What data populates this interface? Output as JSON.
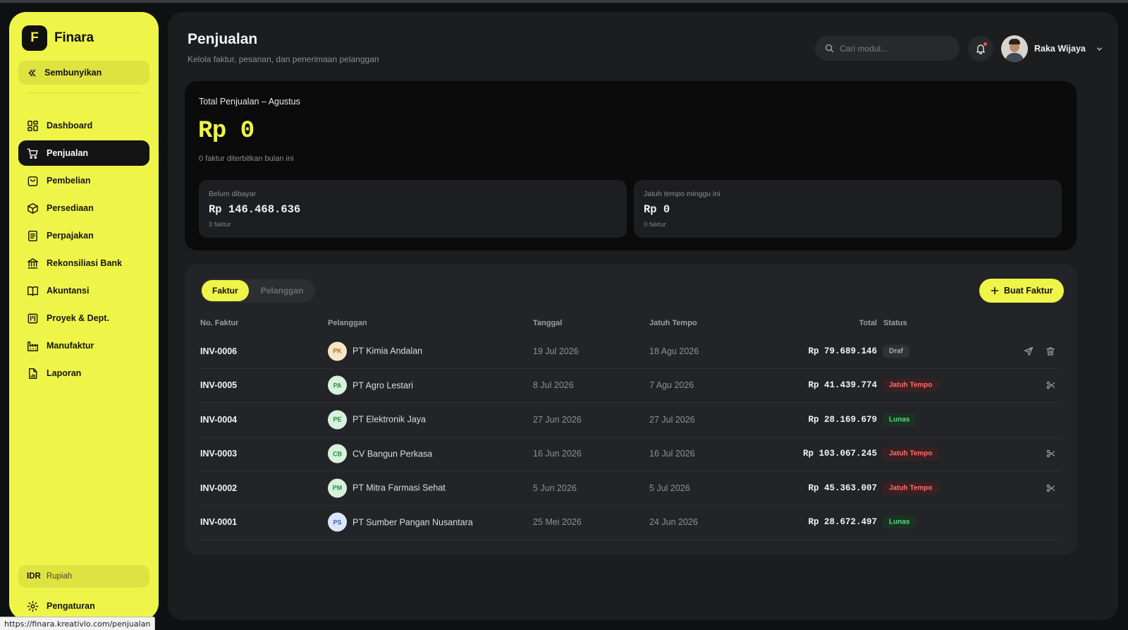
{
  "brand": {
    "logo_letter": "F",
    "name": "Finara"
  },
  "sidebar": {
    "collapse_label": "Sembunyikan",
    "items": [
      {
        "label": "Dashboard",
        "icon": "grid-icon",
        "active": false
      },
      {
        "label": "Penjualan",
        "icon": "cart-icon",
        "active": true
      },
      {
        "label": "Pembelian",
        "icon": "shopping-bag-icon",
        "active": false
      },
      {
        "label": "Persediaan",
        "icon": "box-icon",
        "active": false
      },
      {
        "label": "Perpajakan",
        "icon": "document-icon",
        "active": false
      },
      {
        "label": "Rekonsiliasi Bank",
        "icon": "bank-icon",
        "active": false
      },
      {
        "label": "Akuntansi",
        "icon": "book-icon",
        "active": false
      },
      {
        "label": "Proyek & Dept.",
        "icon": "kanban-icon",
        "active": false
      },
      {
        "label": "Manufaktur",
        "icon": "factory-icon",
        "active": false
      },
      {
        "label": "Laporan",
        "icon": "report-icon",
        "active": false
      }
    ],
    "currency": {
      "code": "IDR",
      "name": "Rupiah"
    },
    "settings_label": "Pengaturan"
  },
  "status_url": "https://finara.kreativlo.com/penjualan",
  "header": {
    "title": "Penjualan",
    "subtitle": "Kelola faktur, pesanan, dan penerimaan pelanggan",
    "search_placeholder": "Cari modul...",
    "user_name": "Raka Wijaya"
  },
  "summary": {
    "title": "Total Penjualan – Agustus",
    "value": "Rp 0",
    "subtitle": "0 faktur diterbitkan bulan ini",
    "stats": [
      {
        "label": "Belum dibayar",
        "value": "Rp 146.468.636",
        "count": "3 faktur"
      },
      {
        "label": "Jatuh tempo minggu ini",
        "value": "Rp 0",
        "count": "0 faktur"
      }
    ]
  },
  "invoices": {
    "tabs": [
      {
        "label": "Faktur",
        "active": true
      },
      {
        "label": "Pelanggan",
        "active": false
      }
    ],
    "create_label": "Buat Faktur",
    "columns": {
      "no": "No. Faktur",
      "customer": "Pelanggan",
      "date": "Tanggal",
      "due": "Jatuh Tempo",
      "total": "Total",
      "status": "Status"
    },
    "rows": [
      {
        "no": "INV-0006",
        "initials": "PK",
        "customer": "PT Kimia Andalan",
        "date": "19 Jul 2026",
        "due": "18 Agu 2026",
        "total": "Rp 79.689.146",
        "status": "Draf",
        "status_kind": "draft",
        "avatar_bg": "#f6e6c7",
        "avatar_fg": "#b0742a",
        "actions": [
          "send-icon",
          "trash-icon"
        ]
      },
      {
        "no": "INV-0005",
        "initials": "PA",
        "customer": "PT Agro Lestari",
        "date": "8 Jul 2026",
        "due": "7 Agu 2026",
        "total": "Rp 41.439.774",
        "status": "Jatuh Tempo",
        "status_kind": "overdue",
        "avatar_bg": "#d6f1dc",
        "avatar_fg": "#2f8a48",
        "actions": [
          "reminder-icon"
        ]
      },
      {
        "no": "INV-0004",
        "initials": "PE",
        "customer": "PT Elektronik Jaya",
        "date": "27 Jun 2026",
        "due": "27 Jul 2026",
        "total": "Rp 28.169.679",
        "status": "Lunas",
        "status_kind": "paid",
        "avatar_bg": "#d6f1dc",
        "avatar_fg": "#2f8a48",
        "actions": []
      },
      {
        "no": "INV-0003",
        "initials": "CB",
        "customer": "CV Bangun Perkasa",
        "date": "16 Jun 2026",
        "due": "16 Jul 2026",
        "total": "Rp 103.067.245",
        "status": "Jatuh Tempo",
        "status_kind": "overdue",
        "avatar_bg": "#d6f1dc",
        "avatar_fg": "#2f8a48",
        "actions": [
          "reminder-icon"
        ]
      },
      {
        "no": "INV-0002",
        "initials": "PM",
        "customer": "PT Mitra Farmasi Sehat",
        "date": "5 Jun 2026",
        "due": "5 Jul 2026",
        "total": "Rp 45.363.007",
        "status": "Jatuh Tempo",
        "status_kind": "overdue",
        "avatar_bg": "#d6f1dc",
        "avatar_fg": "#2f8a48",
        "actions": [
          "reminder-icon"
        ]
      },
      {
        "no": "INV-0001",
        "initials": "PS",
        "customer": "PT Sumber Pangan Nusantara",
        "date": "25 Mei 2026",
        "due": "24 Jun 2026",
        "total": "Rp 28.672.497",
        "status": "Lunas",
        "status_kind": "paid",
        "avatar_bg": "#dbe6fb",
        "avatar_fg": "#3a62c0",
        "actions": []
      }
    ]
  },
  "colors": {
    "accent": "#eff548",
    "background": "#0f1011",
    "panel": "#1c1d1f",
    "overdue": "#ff6f6f",
    "paid": "#5fd885"
  }
}
